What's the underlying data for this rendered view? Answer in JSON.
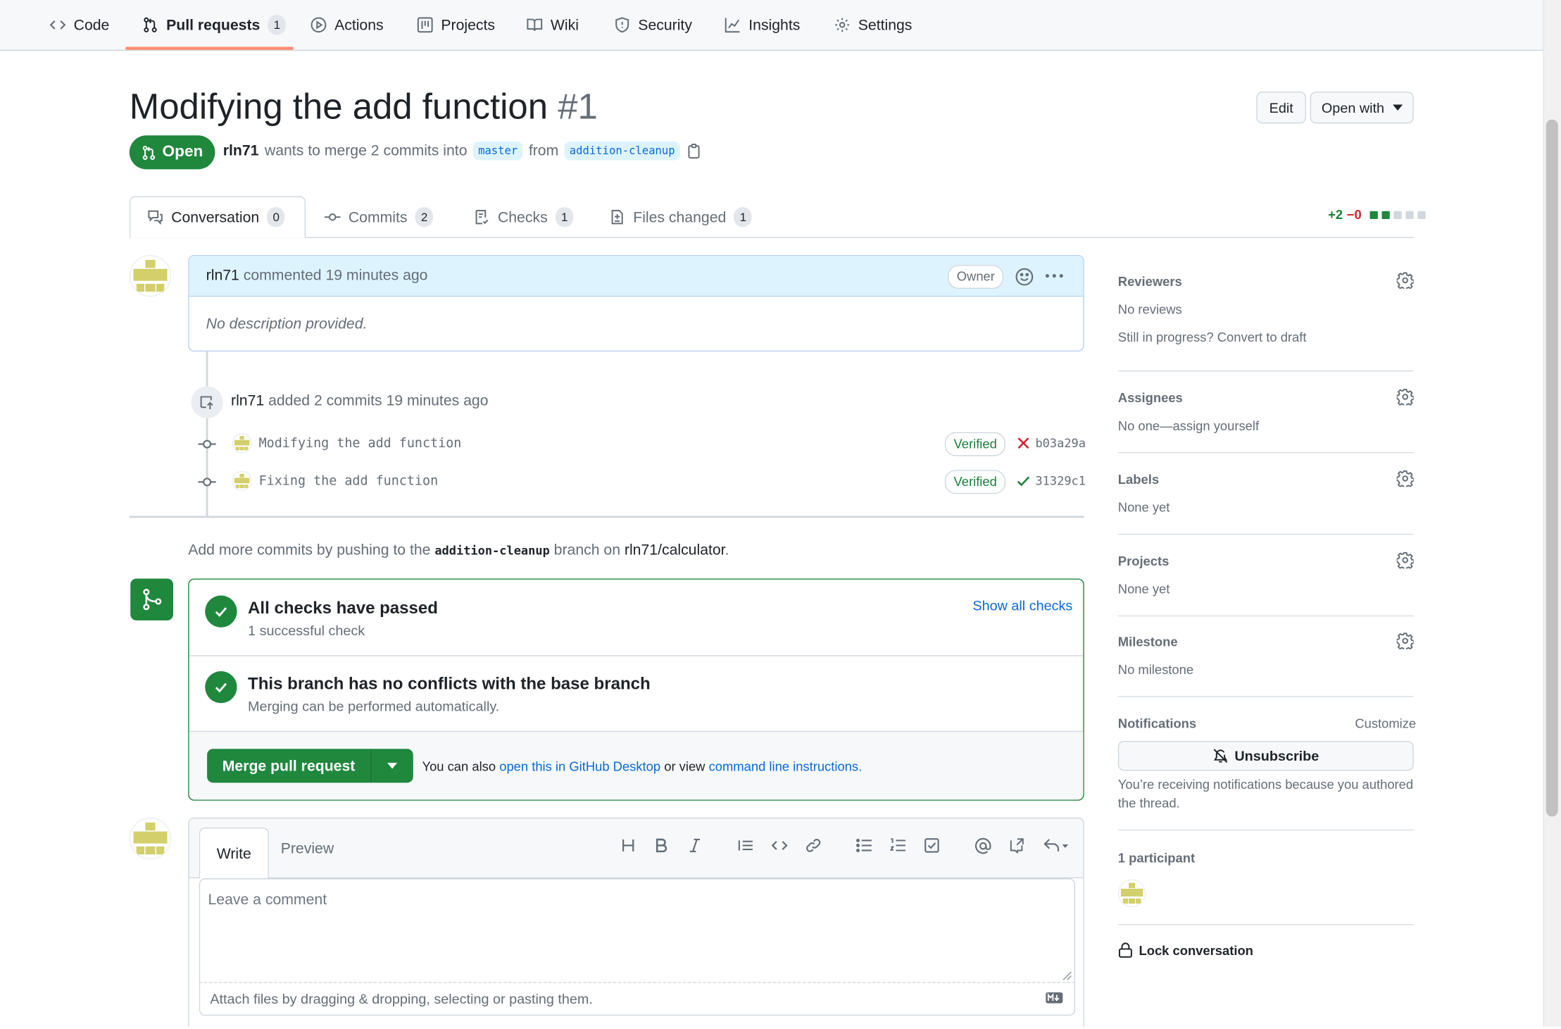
{
  "repo_nav": {
    "code": "Code",
    "pull_requests": "Pull requests",
    "pull_requests_count": "1",
    "actions": "Actions",
    "projects": "Projects",
    "wiki": "Wiki",
    "security": "Security",
    "insights": "Insights",
    "settings": "Settings"
  },
  "header": {
    "title": "Modifying the add function",
    "number": "#1",
    "edit_label": "Edit",
    "open_with_label": "Open with",
    "state": "Open",
    "author": "rln71",
    "meta_middle": "wants to merge 2 commits into",
    "base_branch": "master",
    "meta_from": "from",
    "head_branch": "addition-cleanup"
  },
  "tabs": [
    {
      "label": "Conversation",
      "count": "0"
    },
    {
      "label": "Commits",
      "count": "2"
    },
    {
      "label": "Checks",
      "count": "1"
    },
    {
      "label": "Files changed",
      "count": "1"
    }
  ],
  "diffstat": {
    "additions": "+2",
    "deletions": "−0"
  },
  "comment": {
    "author": "rln71",
    "action": "commented 19 minutes ago",
    "badge": "Owner",
    "body": "No description provided."
  },
  "commits_event": {
    "author": "rln71",
    "text": "added 2 commits 19 minutes ago",
    "commits": [
      {
        "message": "Modifying the add function",
        "verified": "Verified",
        "sha": "b03a29a",
        "status": "failure"
      },
      {
        "message": "Fixing the add function",
        "verified": "Verified",
        "sha": "31329c1",
        "status": "success"
      }
    ]
  },
  "push_note": {
    "prefix": "Add more commits by pushing to the",
    "branch": "addition-cleanup",
    "middle": "branch on",
    "repo": "rln71/calculator",
    "suffix": "."
  },
  "merge_box": {
    "checks_title": "All checks have passed",
    "checks_sub": "1 successful check",
    "show_all": "Show all checks",
    "conflicts_title": "This branch has no conflicts with the base branch",
    "conflicts_sub": "Merging can be performed automatically.",
    "merge_button": "Merge pull request",
    "note_prefix": "You can also",
    "note_link1": "open this in GitHub Desktop",
    "note_middle": "or view",
    "note_link2": "command line instructions",
    "note_suffix": "."
  },
  "editor": {
    "write_tab": "Write",
    "preview_tab": "Preview",
    "placeholder": "Leave a comment",
    "attach_text": "Attach files by dragging & dropping, selecting or pasting them."
  },
  "sidebar": {
    "reviewers_title": "Reviewers",
    "reviewers_value": "No reviews",
    "reviewers_draft": "Still in progress? Convert to draft",
    "assignees_title": "Assignees",
    "assignees_value": "No one—assign yourself",
    "labels_title": "Labels",
    "labels_value": "None yet",
    "projects_title": "Projects",
    "projects_value": "None yet",
    "milestone_title": "Milestone",
    "milestone_value": "No milestone",
    "notifications_title": "Notifications",
    "notifications_customize": "Customize",
    "unsubscribe": "Unsubscribe",
    "notifications_line1": "You’re receiving notifications because you authored",
    "notifications_line2": "the thread.",
    "participants": "1 participant",
    "lock": "Lock conversation"
  }
}
